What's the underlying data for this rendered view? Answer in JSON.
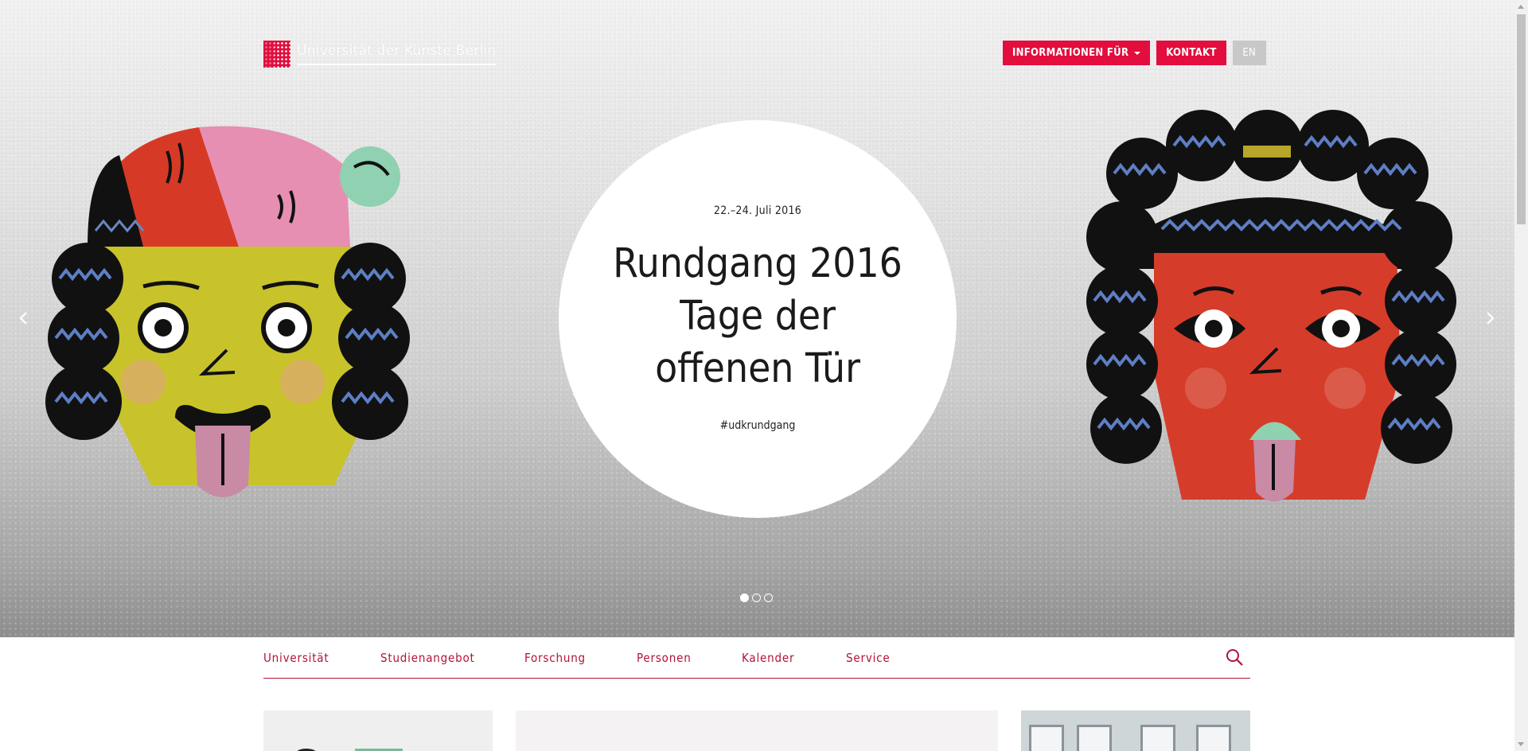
{
  "header": {
    "logo_text": "Universität der Künste Berlin",
    "buttons": {
      "info_for": "INFORMATIONEN FÜR",
      "contact": "KONTAKT",
      "language": "EN"
    }
  },
  "hero": {
    "date": "22.–24. Juli 2016",
    "title": "Rundgang 2016 Tage der offenen Tür",
    "hashtag": "#udkrundgang",
    "slides_count": 3,
    "active_slide": 1,
    "icons": {
      "prev": "chevron-left-icon",
      "next": "chevron-right-icon"
    }
  },
  "nav": {
    "items": [
      "Universität",
      "Studienangebot",
      "Forschung",
      "Personen",
      "Kalender",
      "Service"
    ],
    "search_icon": "search-icon"
  },
  "colors": {
    "brand_red": "#e30d3e",
    "nav_red": "#b3123a",
    "lang_grey": "#c8c8c8"
  }
}
